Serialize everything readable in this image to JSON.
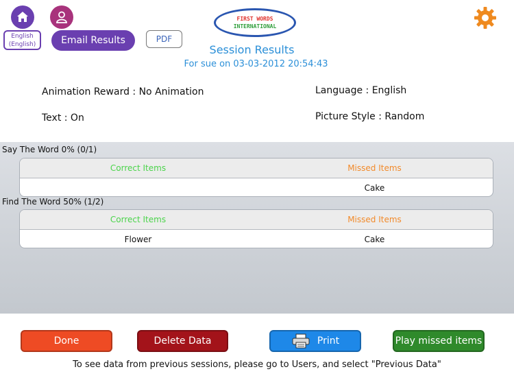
{
  "header": {
    "language_button_line1": "English",
    "language_button_line2": "(English)",
    "email_label": "Email Results",
    "pdf_label": "PDF",
    "logo_line1": "FIRST WORDS",
    "logo_line2": "INTERNATIONAL",
    "title": "Session Results",
    "subtitle": "For sue on 03-03-2012 20:54:43"
  },
  "settings": {
    "animation_reward": "Animation Reward : No Animation",
    "language": "Language :  English",
    "text": "Text : On",
    "picture_style": "Picture Style :  Random"
  },
  "sections": [
    {
      "label": "Say The Word  0%  (0/1)",
      "correct_header": "Correct Items",
      "missed_header": "Missed Items",
      "correct_item": "",
      "missed_item": "Cake"
    },
    {
      "label": "Find The Word  50%  (1/2)",
      "correct_header": "Correct Items",
      "missed_header": "Missed Items",
      "correct_item": "Flower",
      "missed_item": "Cake"
    }
  ],
  "buttons": {
    "done": "Done",
    "delete": "Delete Data",
    "print": "Print",
    "play_missed": "Play missed items"
  },
  "footer_note": "To see data from previous sessions, please go to Users, and select \"Previous Data\"",
  "colors": {
    "purple": "#6a3fb0",
    "blue_text": "#2b8fd8",
    "correct_green": "#4bd44b",
    "missed_orange": "#f28a2a",
    "done_orange": "#ee4b24",
    "delete_red": "#a3131a",
    "print_blue": "#1e88e8",
    "play_green": "#2f8a2b"
  },
  "icons": [
    "home-icon",
    "user-icon",
    "gear-icon",
    "printer-icon"
  ]
}
